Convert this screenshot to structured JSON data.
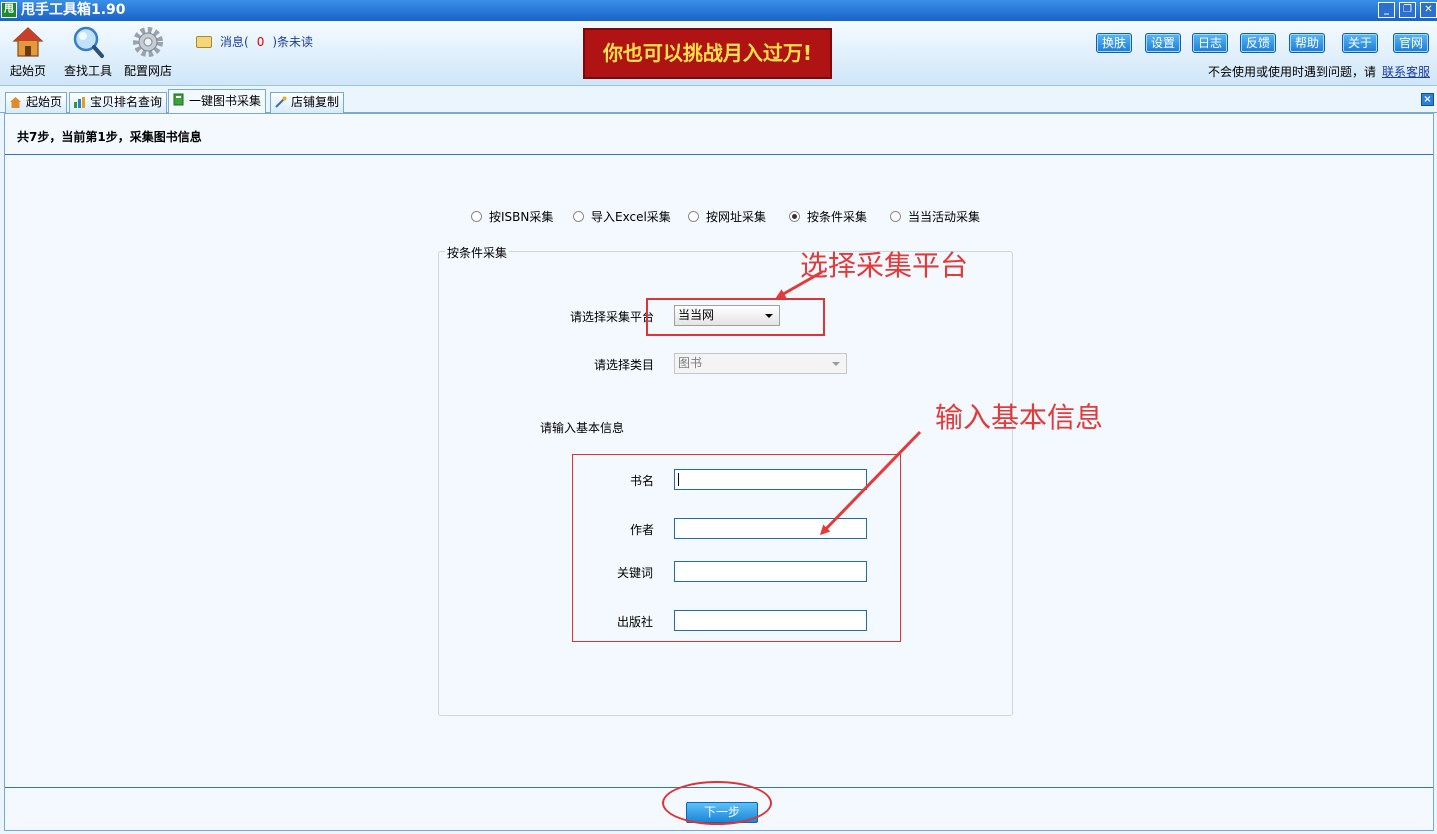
{
  "window": {
    "title": "甩手工具箱1.90",
    "icon_text": "甩",
    "controls": [
      "_",
      "❐",
      "✕"
    ]
  },
  "toolbar": {
    "tools": [
      {
        "label": "起始页",
        "icon": "home-icon"
      },
      {
        "label": "查找工具",
        "icon": "magnifier-icon"
      },
      {
        "label": "配置网店",
        "icon": "gear-icon"
      }
    ],
    "message_prefix": "消息(",
    "message_count": "0",
    "message_suffix": ")条未读",
    "banner_text": "你也可以挑战月入过万!",
    "buttons": [
      "换肤",
      "设置",
      "日志",
      "反馈",
      "帮助",
      "关于",
      "官网"
    ],
    "help_text": "不会使用或使用时遇到问题，请",
    "help_link": "联系客服"
  },
  "tabs": [
    {
      "label": "起始页",
      "icon": "home-icon"
    },
    {
      "label": "宝贝排名查询",
      "icon": "bar-chart-icon"
    },
    {
      "label": "一键图书采集",
      "icon": "book-icon",
      "active": true
    },
    {
      "label": "店铺复制",
      "icon": "brush-icon"
    }
  ],
  "main": {
    "step_text": "共7步，当前第1步，采集图书信息",
    "modes": [
      {
        "label": "按ISBN采集",
        "selected": false
      },
      {
        "label": "导入Excel采集",
        "selected": false
      },
      {
        "label": "按网址采集",
        "selected": false
      },
      {
        "label": "按条件采集",
        "selected": true
      },
      {
        "label": "当当活动采集",
        "selected": false
      }
    ],
    "group_title": "按条件采集",
    "platform_label": "请选择采集平台",
    "platform_value": "当当网",
    "category_label": "请选择类目",
    "category_value": "图书",
    "basic_info_label": "请输入基本信息",
    "fields": {
      "book_name": {
        "label": "书名",
        "value": ""
      },
      "author": {
        "label": "作者",
        "value": ""
      },
      "keyword": {
        "label": "关键词",
        "value": ""
      },
      "publisher": {
        "label": "出版社",
        "value": ""
      }
    },
    "next_button": "下一步"
  },
  "annotations": {
    "select_platform": "选择采集平台",
    "enter_info": "输入基本信息",
    "color": "#e33a3a"
  }
}
